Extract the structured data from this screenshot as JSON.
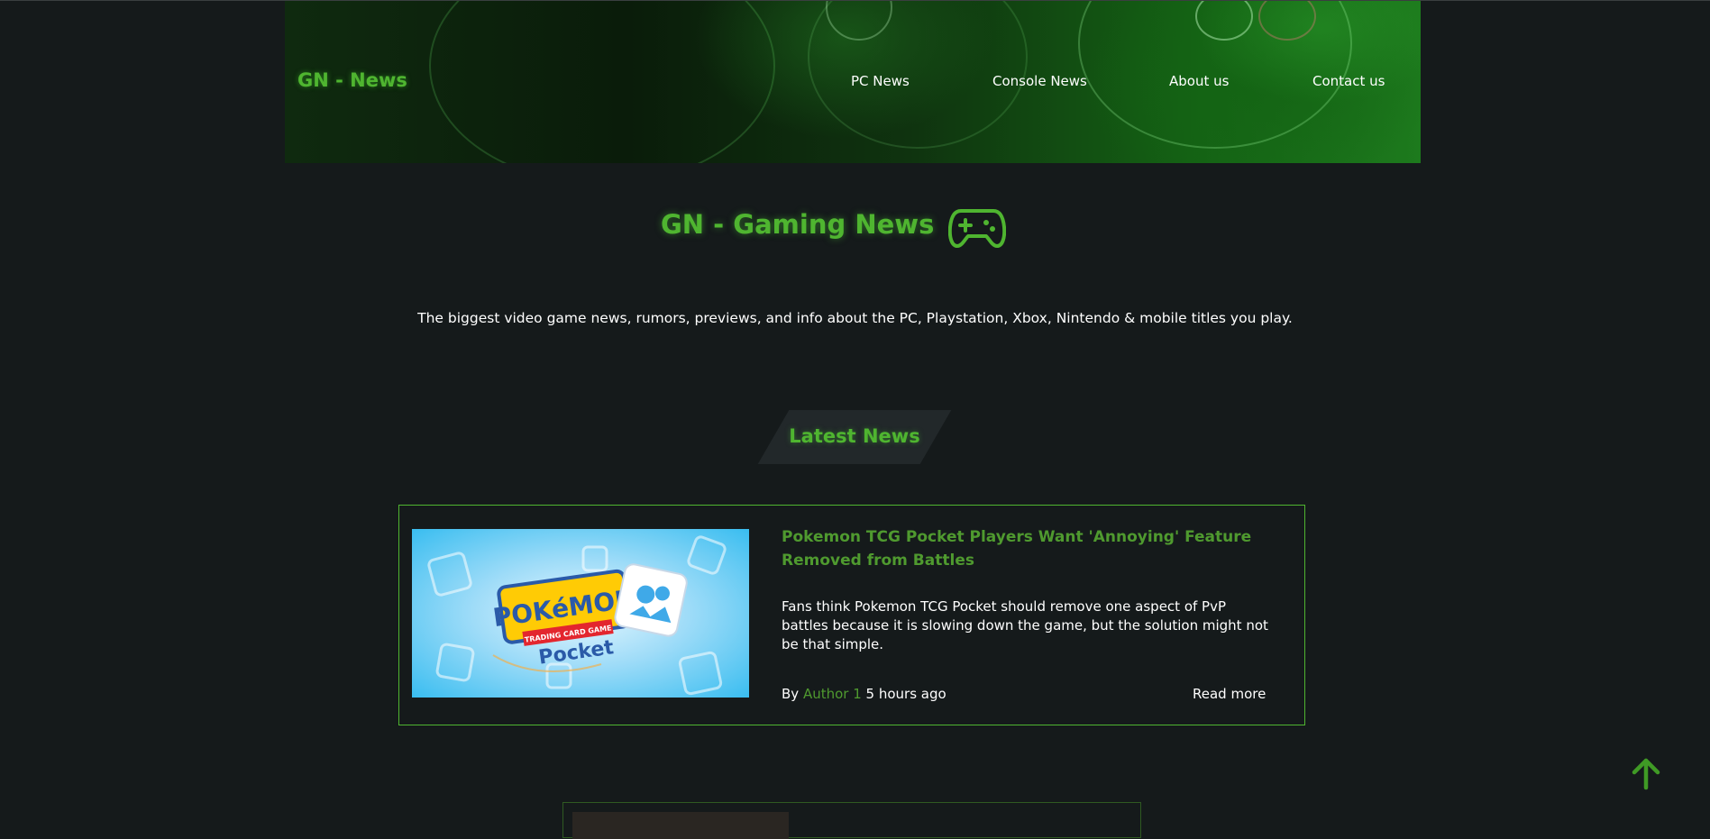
{
  "header": {
    "brand": "GN - News",
    "nav": [
      {
        "label": "PC News"
      },
      {
        "label": "Console News"
      },
      {
        "label": "About us"
      },
      {
        "label": "Contact us"
      }
    ]
  },
  "hero": {
    "title": "GN - Gaming News",
    "icon": "gamepad-icon",
    "tagline": "The biggest video game news, rumors, previews, and info about the PC, Playstation, Xbox, Nintendo & mobile titles you play."
  },
  "latest": {
    "heading": "Latest News",
    "articles": [
      {
        "title": "Pokemon TCG Pocket Players Want 'Annoying' Feature Removed from Battles",
        "description": "Fans think Pokemon TCG Pocket should remove one aspect of PvP battles because it is slowing down the game, but the solution might not be that simple.",
        "by": "By",
        "author": "Author 1",
        "time": "5 hours ago",
        "read_more": "Read more",
        "image_logo_top": "POKéMON",
        "image_logo_band": "TRADING CARD GAME",
        "image_logo_bottom": "Pocket"
      }
    ]
  },
  "colors": {
    "accent": "#4fb530",
    "background": "#151a1b"
  },
  "scroll_top_icon": "arrow-up-icon"
}
